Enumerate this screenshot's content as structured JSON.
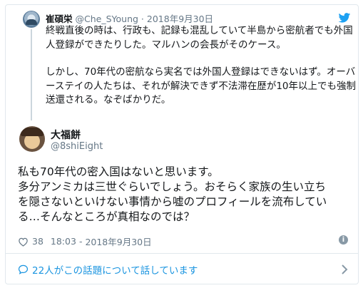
{
  "quoted_tweet": {
    "name": "崔碩栄",
    "handle": "@Che_SYoung",
    "separator": "·",
    "date": "2018年9月30日",
    "paragraphs": [
      "終戦直後の時は、行政も、記録も混乱していて半島から密航者でも外国人登録ができたりした。マルハンの会長がそのケース。",
      "しかし、70年代の密航なら実名では外国人登録はできないはず。オーバーステイの人たちは、それが解決できず不法滞在歴が10年以上でも強制送還される。なぞばかりだ。"
    ]
  },
  "tweet": {
    "name": "大福餅",
    "handle": "@8shiEight",
    "lines": [
      "私も70年代の密入国はないと思います。",
      "多分アンミカは三世ぐらいでしょう。おそらく家族の生い立ち",
      "を隠さないといけない事情から嘘のプロフィールを流布してい",
      "る…そんなところが真相なのでは？"
    ],
    "likes": "38",
    "time": "18:03",
    "separator": "-",
    "date": "2018年9月30日"
  },
  "conversation": {
    "label": "22人がこの話題について話しています"
  },
  "colors": {
    "link_blue": "#1b95e0",
    "twitter_blue": "#1da1f2",
    "secondary_text": "#657786"
  }
}
